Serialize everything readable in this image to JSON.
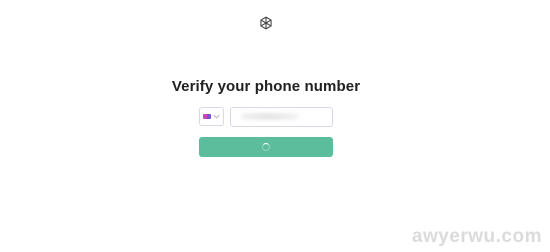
{
  "header": {
    "logo_icon": "openai-logo-icon"
  },
  "main": {
    "title": "Verify your phone number",
    "country_select": {
      "flag_icon": "flag-icon",
      "chevron_icon": "chevron-down-icon"
    },
    "phone_input": {
      "value": "",
      "placeholder": ""
    },
    "continue_button": {
      "state": "loading",
      "spinner_icon": "spinner-icon"
    }
  },
  "watermark": {
    "text": "awyerwu.com"
  },
  "colors": {
    "accent": "#5bbd9c",
    "text": "#202123",
    "border": "#d9d9e3"
  }
}
